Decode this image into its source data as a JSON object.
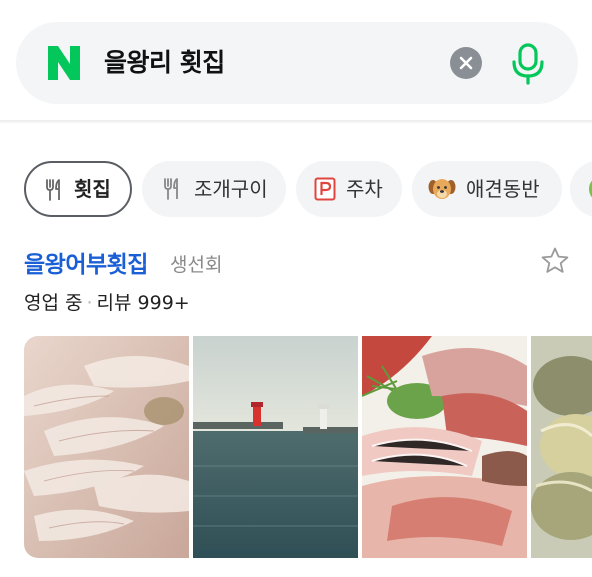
{
  "search": {
    "query": "을왕리 횟집",
    "logo_letter": "N",
    "logo_color": "#03c75a",
    "clear_icon": "close-icon",
    "mic_icon": "microphone-icon"
  },
  "chips": [
    {
      "label": "횟집",
      "icon": "fork-knife-icon",
      "active": true
    },
    {
      "label": "조개구이",
      "icon": "fork-knife-icon",
      "active": false
    },
    {
      "label": "주차",
      "icon": "parking-icon",
      "active": false
    },
    {
      "label": "애견동반",
      "icon": "dog-icon",
      "active": false
    }
  ],
  "place": {
    "name": "을왕어부횟집",
    "category": "생선회",
    "open_status": "영업 중",
    "separator": "·",
    "review_label": "리뷰 999+",
    "accent_color": "#1a5fd6"
  },
  "photos": [
    {
      "name": "sashimi-photo"
    },
    {
      "name": "harbor-lighthouse-photo"
    },
    {
      "name": "sashimi-platter-photo"
    },
    {
      "name": "abalone-photo"
    }
  ]
}
